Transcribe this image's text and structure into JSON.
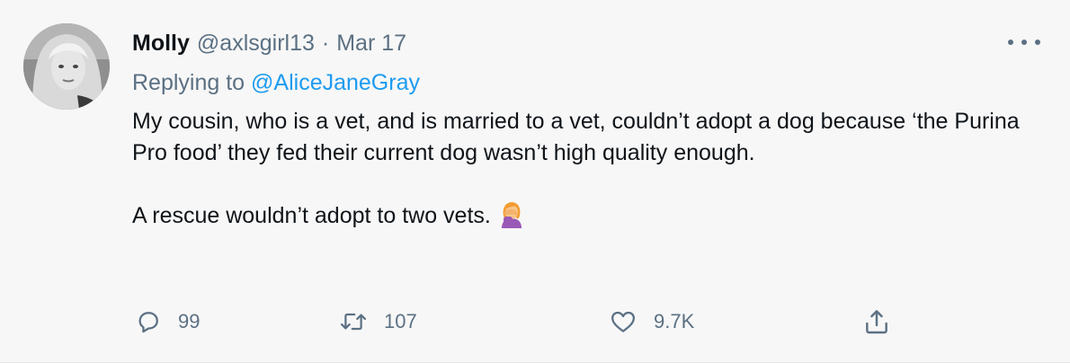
{
  "tweet": {
    "display_name": "Molly",
    "handle": "@axlsgirl13",
    "separator": "·",
    "date": "Mar 17",
    "replying_prefix": "Replying to",
    "replying_to": "@AliceJaneGray",
    "paragraphs": [
      "My cousin, who is a vet, and is married to a vet, couldn’t adopt a dog because ‘the Purina Pro food’ they fed their current dog wasn’t high quality enough.",
      "A rescue wouldn’t adopt to two vets."
    ],
    "emoji_icon": "woman-facepalming-emoji",
    "avatar_icon": "user-avatar-photo",
    "more_icon": "more-options-icon"
  },
  "actions": {
    "reply": {
      "icon": "reply-icon",
      "count": "99"
    },
    "retweet": {
      "icon": "retweet-icon",
      "count": "107"
    },
    "like": {
      "icon": "heart-icon",
      "count": "9.7K"
    },
    "share": {
      "icon": "share-icon"
    }
  },
  "colors": {
    "background": "#f7f7f7",
    "text": "#0f1419",
    "muted": "#5b7083",
    "link": "#1d9bf0"
  }
}
